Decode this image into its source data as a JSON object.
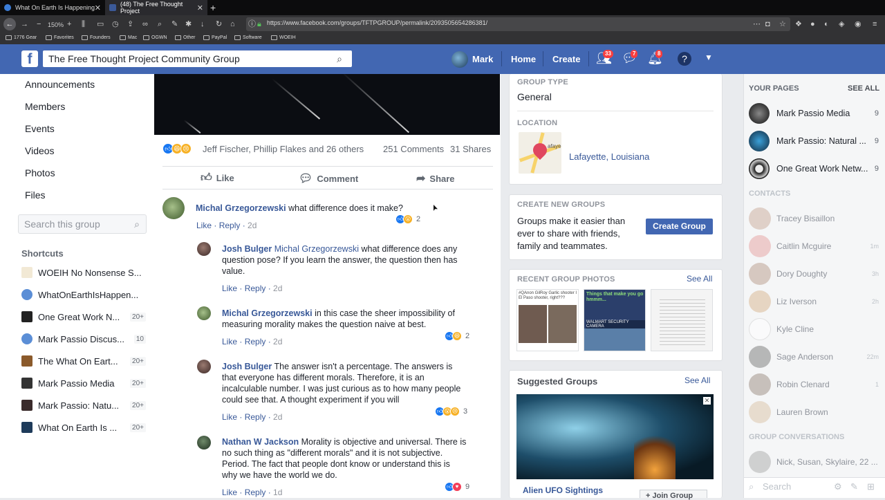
{
  "browser": {
    "tabs": [
      {
        "title": "What On Earth Is Happening",
        "active": false
      },
      {
        "title": "(48) The Free Thought Project",
        "active": true
      }
    ],
    "zoom": "150%",
    "url": "https://www.facebook.com/groups/TFTPGROUP/permalink/2093505654286381/",
    "bookmarks": [
      "1776 Gear",
      "Favorites",
      "Founders",
      "Mac",
      "OGWN",
      "Other",
      "PayPal",
      "Software",
      "WOEIH"
    ]
  },
  "header": {
    "search_value": "The Free Thought Project Community Group",
    "user": "Mark",
    "home": "Home",
    "create": "Create",
    "friend_badge": "33",
    "msg_badge": "7",
    "notif_badge": "8"
  },
  "left_nav": {
    "items": [
      "Announcements",
      "Members",
      "Events",
      "Videos",
      "Photos",
      "Files"
    ],
    "search_placeholder": "Search this group",
    "shortcuts_title": "Shortcuts",
    "shortcuts": [
      {
        "label": "WOEIH No Nonsense S...",
        "count": ""
      },
      {
        "label": "WhatOnEarthIsHappen...",
        "count": ""
      },
      {
        "label": "One Great Work N...",
        "count": "20+"
      },
      {
        "label": "Mark Passio Discus...",
        "count": "10"
      },
      {
        "label": "The What On Eart...",
        "count": "20+"
      },
      {
        "label": "Mark Passio Media",
        "count": "20+"
      },
      {
        "label": "Mark Passio: Natu...",
        "count": "20+"
      },
      {
        "label": "What On Earth Is ...",
        "count": "20+"
      }
    ]
  },
  "post": {
    "reactors": "Jeff Fischer, Phillip Flakes and 26 others",
    "comments": "251 Comments",
    "shares": "31 Shares",
    "like": "Like",
    "comment": "Comment",
    "share": "Share"
  },
  "comments": [
    {
      "name": "Michal Grzegorzewski",
      "mention": "",
      "text": "what difference does it make?",
      "like": "Like",
      "reply": "Reply",
      "time": "2d",
      "reacts": "2"
    },
    {
      "name": "Josh Bulger",
      "mention": "Michal Grzegorzewski",
      "text": "what difference does any question pose? If you learn the answer, the question then has value.",
      "like": "Like",
      "reply": "Reply",
      "time": "2d",
      "reacts": ""
    },
    {
      "name": "Michal Grzegorzewski",
      "mention": "",
      "text": "in this case the sheer impossibility of measuring morality makes the question naive at best.",
      "like": "Like",
      "reply": "Reply",
      "time": "2d",
      "reacts": "2"
    },
    {
      "name": "Josh Bulger",
      "mention": "",
      "text": "The answer isn't a percentage. The answers is that everyone has different morals. Therefore, it is an incalculable number. I was just curious as to how many people could see that. A thought experiment if you will",
      "like": "Like",
      "reply": "Reply",
      "time": "2d",
      "reacts": "3"
    },
    {
      "name": "Nathan W Jackson",
      "mention": "",
      "text": "Morality is objective and universal. There is no such thing as \"different morals\" and it is not subjective. Period. The fact that people dont know or understand this is why we have the world we do.",
      "like": "Like",
      "reply": "Reply",
      "time": "1d",
      "reacts": "9"
    }
  ],
  "about": {
    "type_title": "GROUP TYPE",
    "type_value": "General",
    "location_title": "LOCATION",
    "location_value": "Lafayette, Louisiana",
    "map_label": "afaye",
    "create_title": "CREATE NEW GROUPS",
    "create_text": "Groups make it easier than ever to share with friends, family and teammates.",
    "create_button": "Create Group",
    "photos_title": "RECENT GROUP PHOTOS",
    "photos_see_all": "See All",
    "photo1_caption": "#QAnon GilRoy Garlic shooter I  El Paso shooter, right???",
    "photo2_caption": "Things that make you go hmmm...",
    "photo2_sub": "WALMART SECURITY CAMERA",
    "suggested_title": "Suggested Groups",
    "suggested_see_all": "See All",
    "suggested_name": "Alien UFO Sightings",
    "join_button": "Join Group"
  },
  "right_rail": {
    "pages_title": "YOUR PAGES",
    "pages_see_all": "SEE ALL",
    "pages": [
      {
        "name": "Mark Passio Media",
        "count": "9"
      },
      {
        "name": "Mark Passio: Natural ...",
        "count": "9"
      },
      {
        "name": "One Great Work Netw...",
        "count": "9"
      }
    ],
    "contacts_title": "CONTACTS",
    "contacts": [
      {
        "name": "Tracey Bisaillon",
        "time": ""
      },
      {
        "name": "Caitlin Mcguire",
        "time": "1m"
      },
      {
        "name": "Dory Doughty",
        "time": "3h"
      },
      {
        "name": "Liz Iverson",
        "time": "2h"
      },
      {
        "name": "Kyle Cline",
        "time": ""
      },
      {
        "name": "Sage Anderson",
        "time": "22m"
      },
      {
        "name": "Robin Clenard",
        "time": "1"
      },
      {
        "name": "Lauren Brown",
        "time": ""
      }
    ],
    "conv_title": "GROUP CONVERSATIONS",
    "conv_name": "Nick, Susan, Skylaire, 22 ...",
    "search": "Search"
  },
  "colors": {
    "fb_blue": "#4267b2",
    "link": "#385898",
    "badge": "#fa3e3e"
  }
}
